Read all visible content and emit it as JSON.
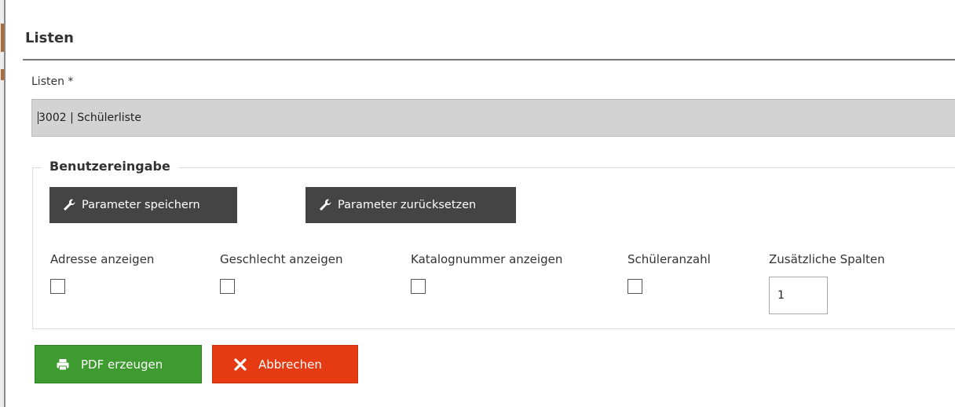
{
  "section": {
    "title": "Listen"
  },
  "list_field": {
    "label": "Listen *",
    "value": "3002 | Schülerliste"
  },
  "user_input": {
    "legend": "Benutzereingabe",
    "save_params_label": "Parameter speichern",
    "reset_params_label": "Parameter zurücksetzen",
    "options": [
      {
        "label": "Adresse anzeigen",
        "checked": false
      },
      {
        "label": "Geschlecht anzeigen",
        "checked": false
      },
      {
        "label": "Katalognummer anzeigen",
        "checked": false
      },
      {
        "label": "Schüleranzahl",
        "checked": false
      }
    ],
    "extra_columns": {
      "label": "Zusätzliche Spalten",
      "value": "1"
    }
  },
  "actions": {
    "pdf_label": "PDF erzeugen",
    "cancel_label": "Abbrechen"
  },
  "icons": {
    "params": "wrench-icon",
    "pdf": "printer-icon",
    "cancel": "close-icon"
  },
  "colors": {
    "dark_button": "#444444",
    "pdf_button": "#3e9b2f",
    "cancel_button": "#e63b12",
    "select_background": "#d3d3d3"
  }
}
